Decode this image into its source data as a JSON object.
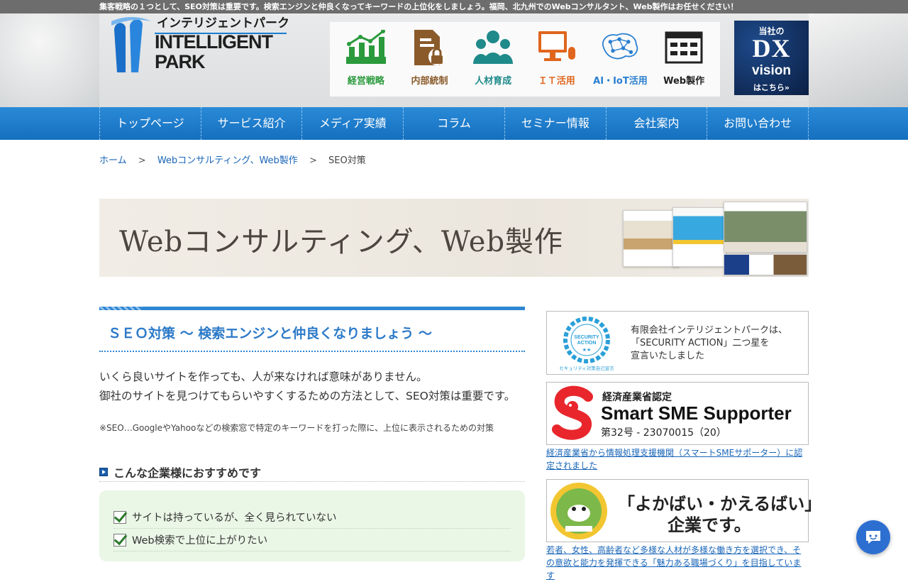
{
  "topbar": {
    "text": "集客戦略の１つとして、SEO対策は重要です。検索エンジンと仲良くなってキーワードの上位化をしましょう。福岡、北九州でのWebコンサルタント、Web製作はお任せください！"
  },
  "logo": {
    "jp": "インテリジェントパーク",
    "en_line1": "INTELLIGENT",
    "en_line2": "PARK"
  },
  "services": [
    {
      "label": "経営戦略",
      "icon": "growth-chart-icon",
      "color": "#2a9a3c"
    },
    {
      "label": "内部統制",
      "icon": "document-lock-icon",
      "color": "#8a5a2a"
    },
    {
      "label": "人材育成",
      "icon": "people-icon",
      "color": "#1f8a8a"
    },
    {
      "label": "ＩＴ活用",
      "icon": "computer-mouse-icon",
      "color": "#e0661e"
    },
    {
      "label": "AI・IoT活用",
      "icon": "ai-brain-network-icon",
      "color": "#2a7fd0"
    },
    {
      "label": "Web製作",
      "icon": "web-window-icon",
      "color": "#222222"
    }
  ],
  "dx_banner": {
    "line1": "当社の",
    "line2": "DX",
    "line3": "vision",
    "line4": "はこちら»"
  },
  "nav": [
    "トップページ",
    "サービス紹介",
    "メディア実績",
    "コラム",
    "セミナー情報",
    "会社案内",
    "お問い合わせ"
  ],
  "breadcrumb": {
    "home": "ホーム",
    "sep": ">",
    "parent": "Webコンサルティング、Web製作",
    "current": "SEO対策"
  },
  "banner": {
    "title": "Webコンサルティング、Web製作"
  },
  "main": {
    "section_title": "ＳＥＯ対策 ～ 検索エンジンと仲良くなりましょう ～",
    "intro_line1": "いくら良いサイトを作っても、人が来なければ意味がありません。",
    "intro_line2": "御社のサイトを見つけてもらいやすくするための方法として、SEO対策は重要です。",
    "note": "※SEO…GoogleやYahooなどの検索窓で特定のキーワードを打った際に、上位に表示されるための対策",
    "sub_heading": "こんな企業様におすすめです",
    "checklist": [
      "サイトは持っているが、全く見られていない",
      "Web検索で上位に上がりたい"
    ]
  },
  "sidebar": {
    "security": {
      "badge_line1": "SECURITY",
      "badge_line2": "ACTION",
      "badge_stars": "★★",
      "badge_caption": "セキュリティ対策自己宣言",
      "text_line1": "有限会社インテリジェントパークは、",
      "text_line2": "「SECURITY ACTION」二つ星を",
      "text_line3": "宣言いたしました"
    },
    "sme": {
      "line1": "経済産業省認定",
      "line2": "Smart SME Supporter",
      "line3": "第32号 - 23070015（20）",
      "link": "経済産業省から情報処理支援機関（スマートSMEサポーター）に認定されました"
    },
    "yokabai": {
      "line1": "「よかばい・かえるばい」",
      "line2": "企業です。",
      "link": "若者、女性、高齢者など多様な人材が多様な働き方を選択でき、その意欲と能力を発揮できる「魅力ある職場づくり」を目指しています"
    }
  },
  "chat": {
    "icon": "chat-bubble-icon"
  }
}
